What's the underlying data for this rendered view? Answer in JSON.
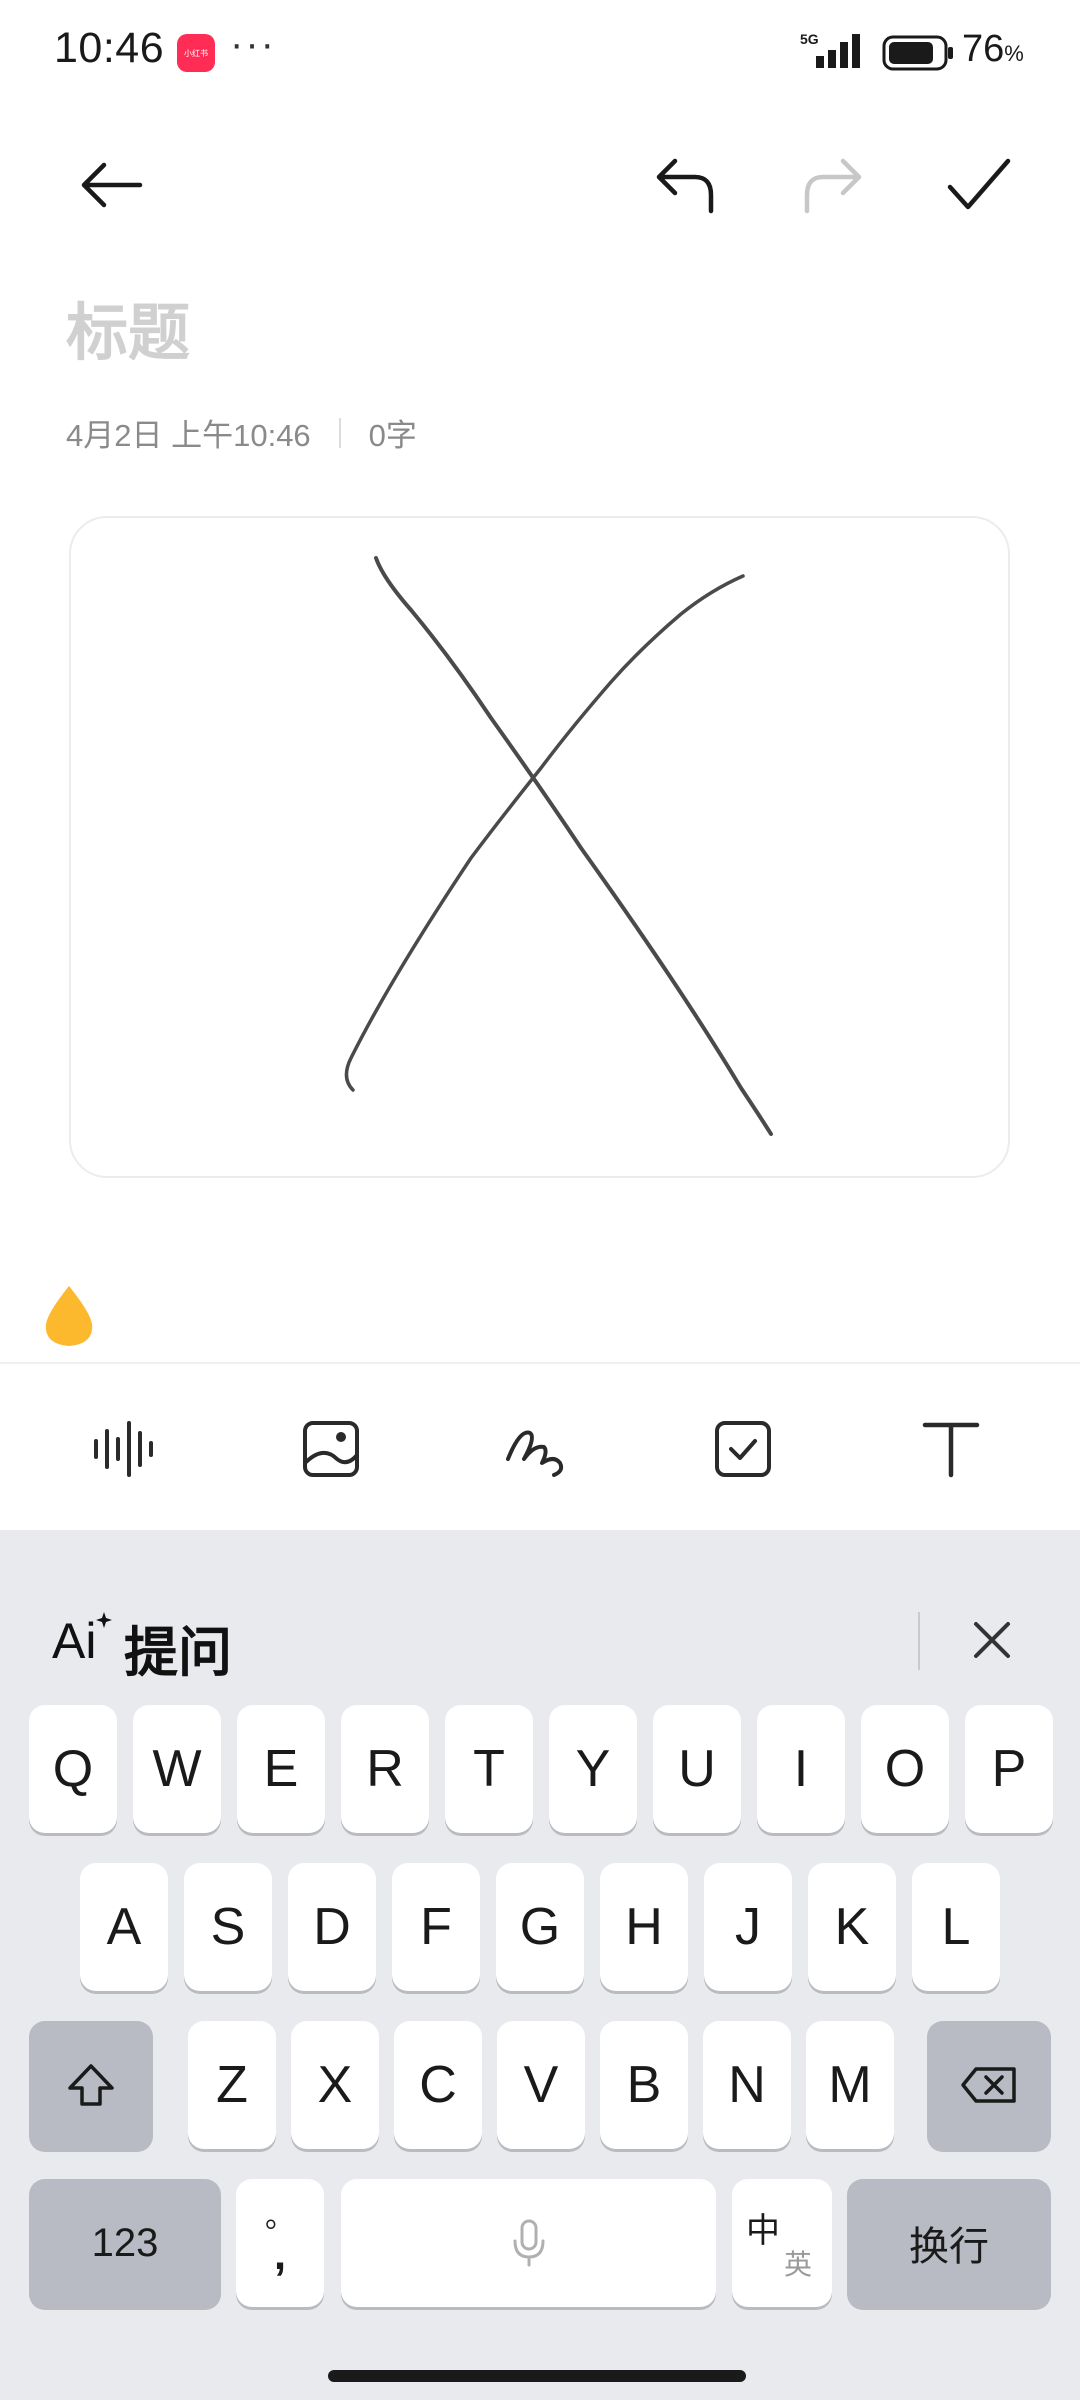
{
  "status_bar": {
    "time": "10:46",
    "app_badge": "小红书",
    "more": "···",
    "network": "5G",
    "battery_pct": "76",
    "battery_unit": "%"
  },
  "toolbar": {
    "back": "back-arrow-icon",
    "undo": "undo-icon",
    "redo": "redo-icon",
    "done": "checkmark-icon"
  },
  "note": {
    "title_placeholder": "标题",
    "date": "4月2日 上午10:46",
    "word_count": "0字"
  },
  "format_bar": {
    "items": [
      "voice-waveform-icon",
      "image-icon",
      "handwriting-icon",
      "checklist-icon",
      "text-format-icon"
    ]
  },
  "keyboard": {
    "ai_label": "提问",
    "ai_logo_text": "Ai",
    "row1": [
      "Q",
      "W",
      "E",
      "R",
      "T",
      "Y",
      "U",
      "I",
      "O",
      "P"
    ],
    "row2": [
      "A",
      "S",
      "D",
      "F",
      "G",
      "H",
      "J",
      "K",
      "L"
    ],
    "row3": [
      "Z",
      "X",
      "C",
      "V",
      "B",
      "N",
      "M"
    ],
    "num_key": "123",
    "punct_top": "。",
    "punct_bottom": ",",
    "lang_zh": "中",
    "lang_en": "英",
    "enter": "换行"
  },
  "colors": {
    "accent_drop": "#FDB92E",
    "keyboard_bg": "#E9EAEE",
    "dark_key": "#B8BBC4"
  }
}
